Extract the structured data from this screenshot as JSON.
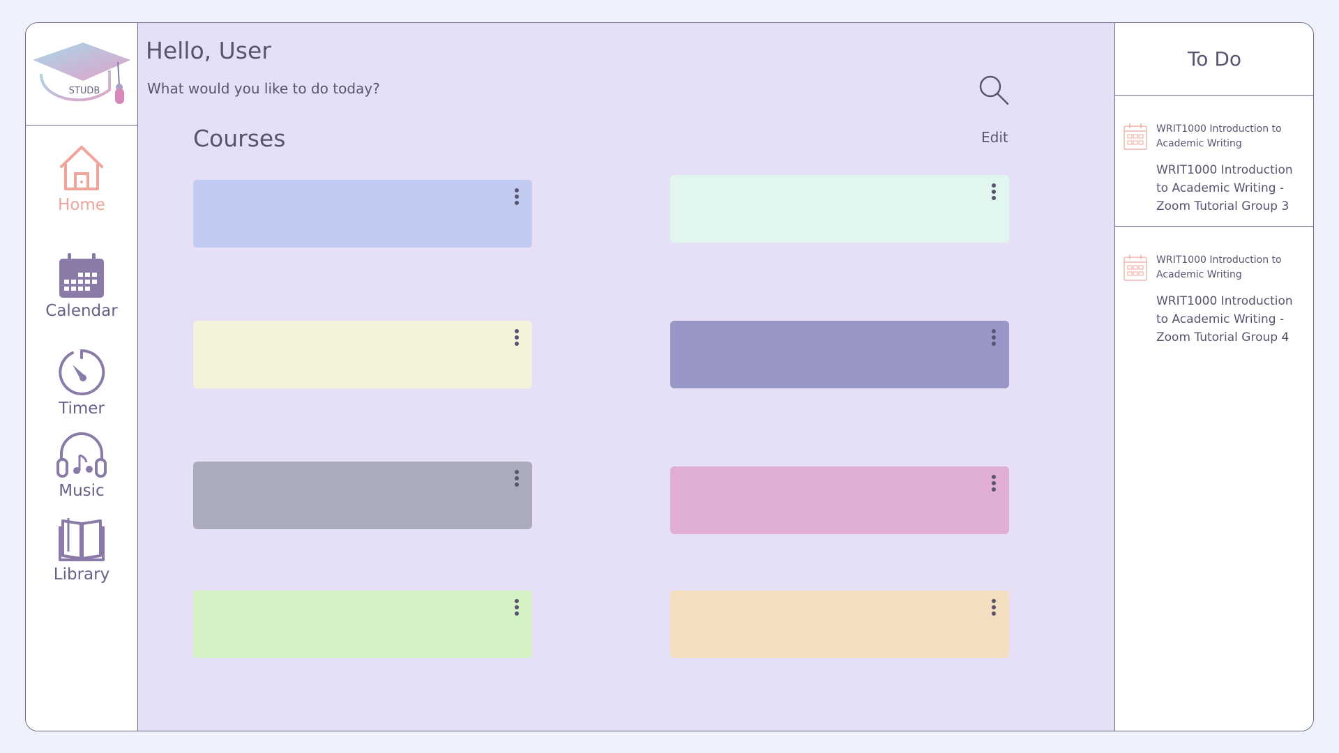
{
  "app": {
    "logo_text": "STUDB",
    "greeting": "Hello, User",
    "subgreeting": "What would you like to do today?"
  },
  "sidebar": {
    "items": [
      {
        "label": "Home",
        "icon": "home-icon",
        "active": true
      },
      {
        "label": "Calendar",
        "icon": "calendar-icon",
        "active": false
      },
      {
        "label": "Timer",
        "icon": "timer-icon",
        "active": false
      },
      {
        "label": "Music",
        "icon": "headphones-icon",
        "active": false
      },
      {
        "label": "Library",
        "icon": "book-icon",
        "active": false
      }
    ]
  },
  "courses": {
    "title": "Courses",
    "edit_label": "Edit",
    "cards": [
      {
        "color": "#c1cbf2"
      },
      {
        "color": "#e0f6ef"
      },
      {
        "color": "#f4f2da"
      },
      {
        "color": "#9796c6"
      },
      {
        "color": "#abacbb"
      },
      {
        "color": "#e1aed6"
      },
      {
        "color": "#d5f2c4"
      },
      {
        "color": "#f4dec0"
      }
    ]
  },
  "todo": {
    "title": "To Do",
    "items": [
      {
        "course": "WRIT1000 Introduction to Academic Writing",
        "title": "WRIT1000 Introduction to Academic Writing - Zoom Tutorial Group 3"
      },
      {
        "course": "WRIT1000 Introduction to Academic Writing",
        "title": "WRIT1000 Introduction to Academic Writing - Zoom Tutorial Group 4"
      }
    ]
  },
  "colors": {
    "accent_active": "#f0a49a",
    "nav_icon": "#8a7aa8",
    "main_bg": "#e5e0f6"
  }
}
